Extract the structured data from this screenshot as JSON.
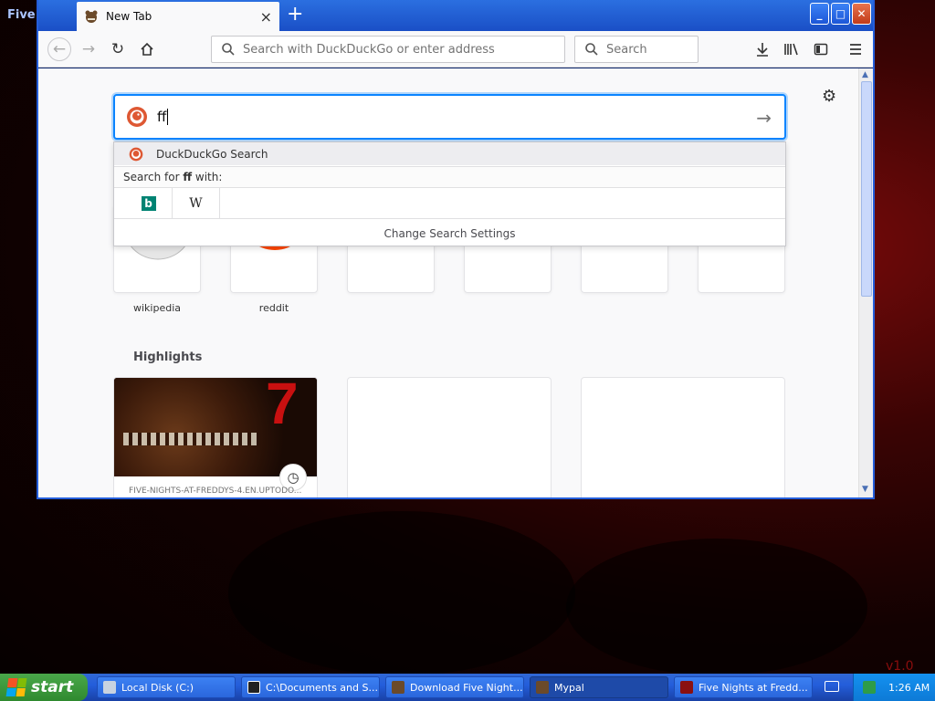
{
  "desktop": {
    "corner_label": "Five",
    "version_mark": "v1.0"
  },
  "window": {
    "tab": {
      "title": "New Tab",
      "close_glyph": "×"
    },
    "new_tab_glyph": "+",
    "controls": {
      "minimize": "_",
      "maximize": "□",
      "close": "✕"
    }
  },
  "toolbar": {
    "url_placeholder": "Search with DuckDuckGo or enter address",
    "search_placeholder": "Search"
  },
  "newtab": {
    "search_query": "ff",
    "dropdown": {
      "suggestion": "DuckDuckGo Search",
      "search_for_prefix": "Search for ",
      "search_for_term": "ff",
      "search_for_suffix": " with:",
      "engines": [
        {
          "name": "bing",
          "glyph": "b"
        },
        {
          "name": "wikipedia",
          "glyph": "W"
        }
      ],
      "settings_label": "Change Search Settings"
    },
    "top_sites": [
      {
        "label": "wikipedia"
      },
      {
        "label": "reddit"
      },
      {
        "label": ""
      },
      {
        "label": ""
      },
      {
        "label": ""
      },
      {
        "label": ""
      }
    ],
    "highlights": {
      "title": "Highlights",
      "cards": [
        {
          "url": "FIVE-NIGHTS-AT-FREDDYS-4.EN.UPTODO..."
        }
      ]
    }
  },
  "taskbar": {
    "start_label": "start",
    "tasks": [
      {
        "label": "Local Disk (C:)",
        "active": false
      },
      {
        "label": "C:\\Documents and S...",
        "active": false
      },
      {
        "label": "Download Five Night...",
        "active": false
      },
      {
        "label": "Mypal",
        "active": true
      },
      {
        "label": "Five Nights at Fredd...",
        "active": false
      }
    ],
    "clock": "1:26 AM"
  },
  "colors": {
    "accent": "#0a84ff",
    "xp_blue": "#245edb",
    "start_green": "#2f8a2f",
    "ddg_orange": "#de5833",
    "reddit_orange": "#ff4500",
    "bing_teal": "#008373"
  }
}
